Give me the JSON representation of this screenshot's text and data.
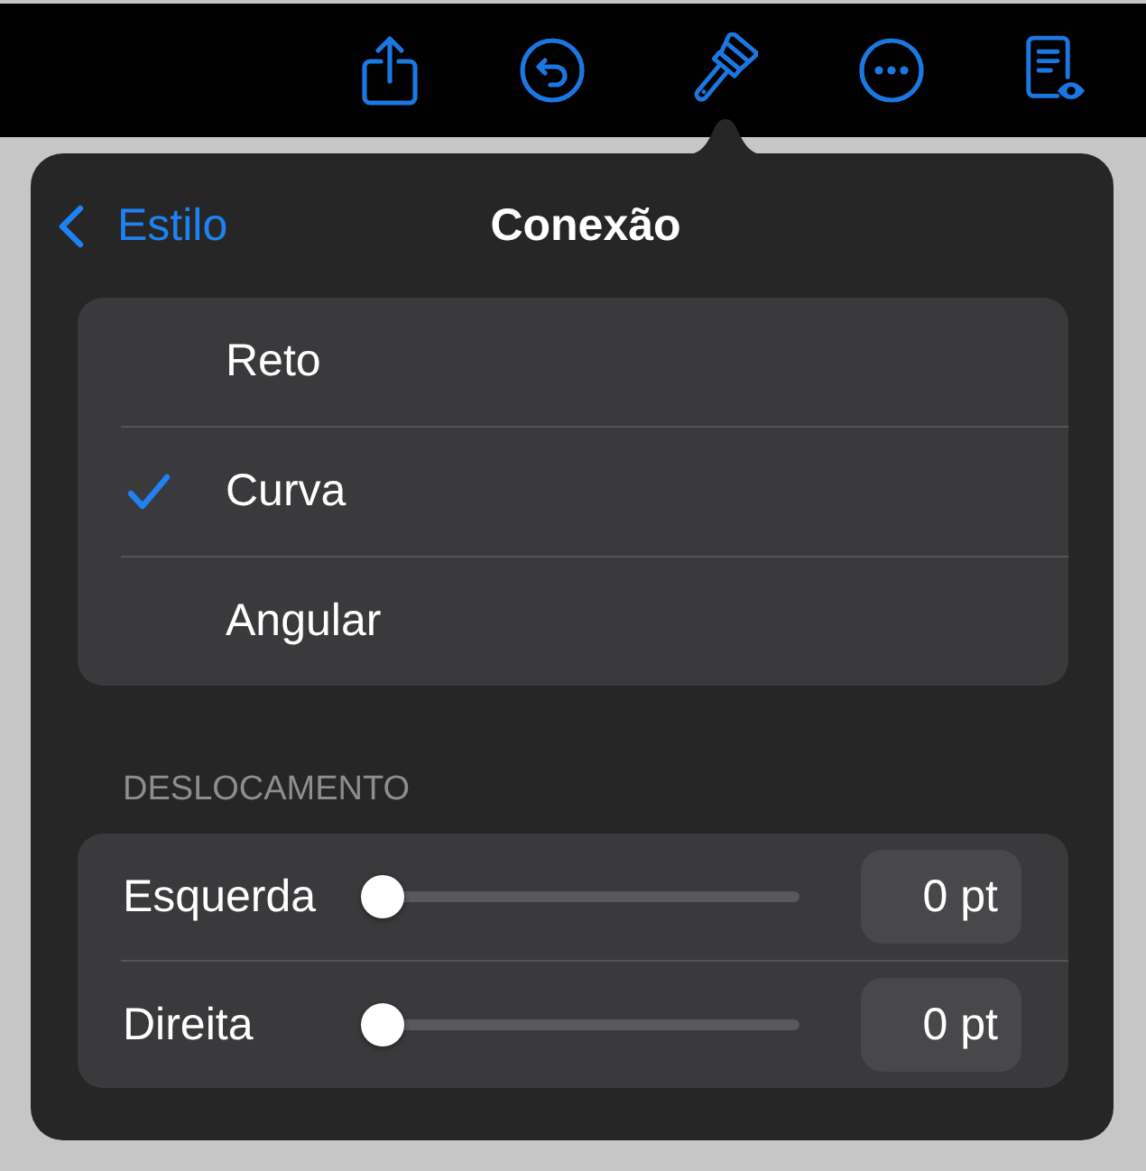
{
  "popover": {
    "back_button": "Estilo",
    "title": "Conexão",
    "options": [
      {
        "label": "Reto",
        "selected": false
      },
      {
        "label": "Curva",
        "selected": true
      },
      {
        "label": "Angular",
        "selected": false
      }
    ],
    "offset": {
      "header": "DESLOCAMENTO",
      "sliders": [
        {
          "label": "Esquerda",
          "level": 0,
          "value": "0 pt"
        },
        {
          "label": "Direita",
          "level": 0,
          "value": "0 pt"
        }
      ]
    }
  }
}
